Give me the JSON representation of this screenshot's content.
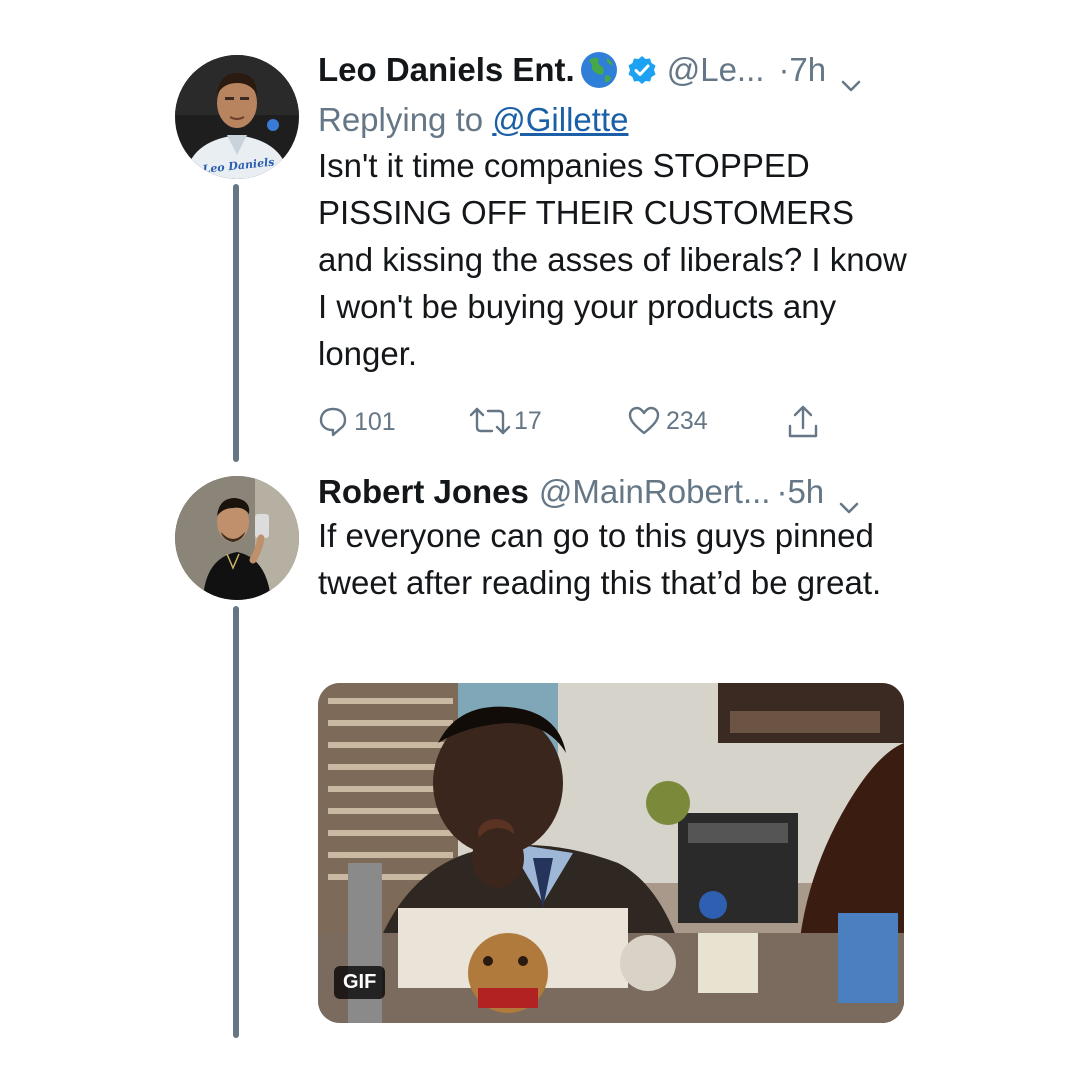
{
  "tweets": [
    {
      "display_name": "Leo Daniels Ent.",
      "handle": "@Le...",
      "time": "·7h",
      "replying_prefix": "Replying to ",
      "replying_to": "@Gillette",
      "text": "Isn't it time companies STOPPED PISSING OFF THEIR CUSTOMERS and kissing the asses of liberals? I know I won't be buying your products any longer.",
      "avatar_caption": "Leo Daniels",
      "replies": "101",
      "retweets": "17",
      "likes": "234"
    },
    {
      "display_name": "Robert Jones",
      "handle": "@MainRobert...",
      "time": "·5h",
      "text": "If everyone can go to this guys pinned tweet after reading this that’d be great.",
      "media_badge": "GIF"
    }
  ],
  "icons": {
    "globe": "globe-icon",
    "verified": "verified-badge-icon",
    "more": "chevron-down-icon",
    "reply": "reply-icon",
    "retweet": "retweet-icon",
    "like": "heart-icon",
    "share": "share-icon"
  },
  "colors": {
    "link": "#1b5fa8",
    "secondary_text": "#657786",
    "verified": "#1da1f2",
    "thread_line": "#657786"
  }
}
